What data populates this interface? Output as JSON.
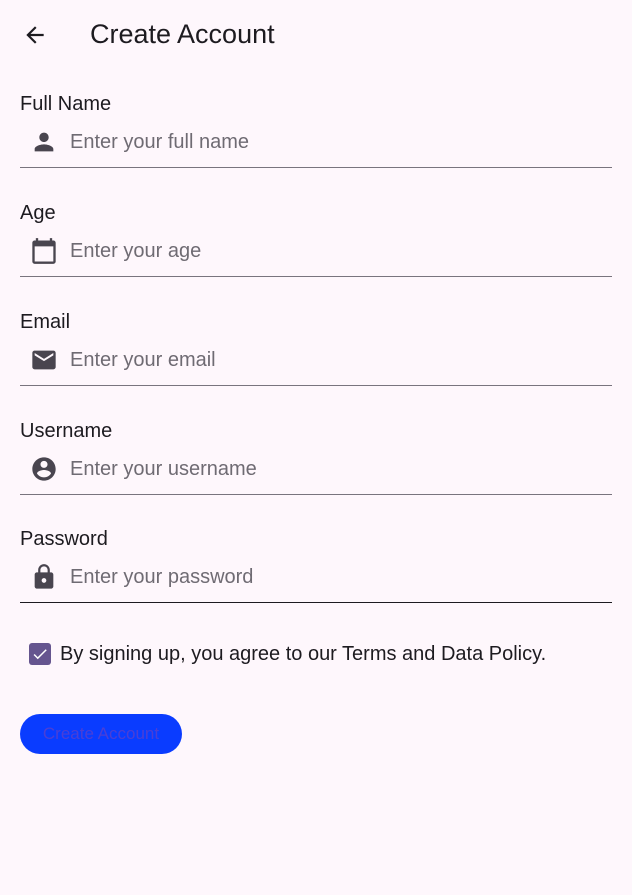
{
  "appbar": {
    "title": "Create Account",
    "back_icon": "arrow-back-icon"
  },
  "form": {
    "fields": [
      {
        "label": "Full Name",
        "placeholder": "Enter your full name",
        "value": "",
        "icon": "person-icon"
      },
      {
        "label": "Age",
        "placeholder": "Enter your age",
        "value": "",
        "icon": "calendar-icon"
      },
      {
        "label": "Email",
        "placeholder": "Enter your email",
        "value": "",
        "icon": "mail-icon"
      },
      {
        "label": "Username",
        "placeholder": "Enter your username",
        "value": "",
        "icon": "account-circle-icon"
      },
      {
        "label": "Password",
        "placeholder": "Enter your password",
        "value": "",
        "icon": "lock-icon"
      }
    ],
    "agree": {
      "checked": true,
      "text": "By signing up, you agree to our Terms and Data Policy."
    },
    "submit_label": "Create Account"
  },
  "colors": {
    "background": "#fef7fc",
    "checkbox": "#65558f",
    "button": "#0a3cff",
    "button_text": "#4a3fd6",
    "icon": "#49454f"
  }
}
